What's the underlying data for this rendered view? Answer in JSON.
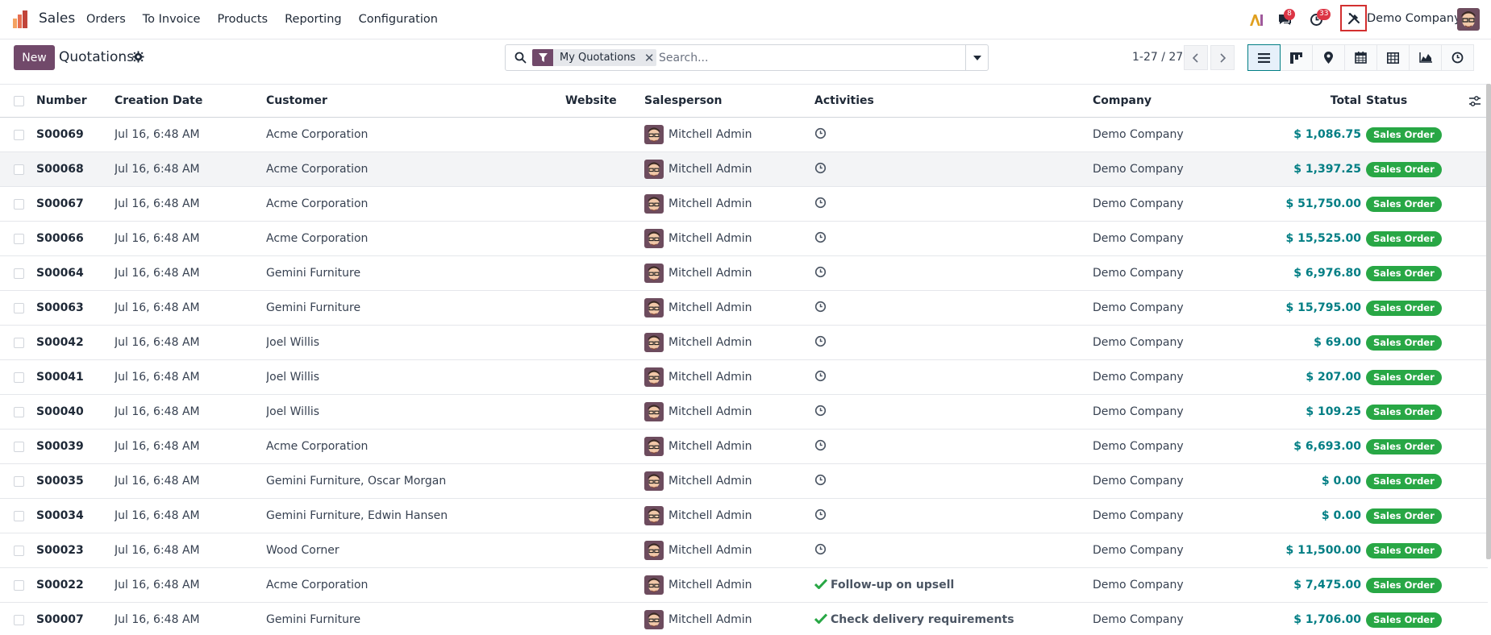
{
  "navbar": {
    "app_name": "Sales",
    "menu": [
      "Orders",
      "To Invoice",
      "Products",
      "Reporting",
      "Configuration"
    ],
    "chat_count": "8",
    "activity_count": "33",
    "company": "Demo Company"
  },
  "control": {
    "new_label": "New",
    "title": "Quotations",
    "facet_label": "My Quotations",
    "search_placeholder": "Search...",
    "pager": "1-27 / 27"
  },
  "table": {
    "headers": {
      "number": "Number",
      "date": "Creation Date",
      "customer": "Customer",
      "website": "Website",
      "salesperson": "Salesperson",
      "activities": "Activities",
      "company": "Company",
      "total": "Total",
      "status": "Status"
    },
    "rows": [
      {
        "number": "S00069",
        "date": "Jul 16, 6:48 AM",
        "customer": "Acme Corporation",
        "salesperson": "Mitchell Admin",
        "activity": "",
        "company": "Demo Company",
        "total": "$ 1,086.75",
        "status": "Sales Order"
      },
      {
        "number": "S00068",
        "date": "Jul 16, 6:48 AM",
        "customer": "Acme Corporation",
        "salesperson": "Mitchell Admin",
        "activity": "",
        "company": "Demo Company",
        "total": "$ 1,397.25",
        "status": "Sales Order"
      },
      {
        "number": "S00067",
        "date": "Jul 16, 6:48 AM",
        "customer": "Acme Corporation",
        "salesperson": "Mitchell Admin",
        "activity": "",
        "company": "Demo Company",
        "total": "$ 51,750.00",
        "status": "Sales Order"
      },
      {
        "number": "S00066",
        "date": "Jul 16, 6:48 AM",
        "customer": "Acme Corporation",
        "salesperson": "Mitchell Admin",
        "activity": "",
        "company": "Demo Company",
        "total": "$ 15,525.00",
        "status": "Sales Order"
      },
      {
        "number": "S00064",
        "date": "Jul 16, 6:48 AM",
        "customer": "Gemini Furniture",
        "salesperson": "Mitchell Admin",
        "activity": "",
        "company": "Demo Company",
        "total": "$ 6,976.80",
        "status": "Sales Order"
      },
      {
        "number": "S00063",
        "date": "Jul 16, 6:48 AM",
        "customer": "Gemini Furniture",
        "salesperson": "Mitchell Admin",
        "activity": "",
        "company": "Demo Company",
        "total": "$ 15,795.00",
        "status": "Sales Order"
      },
      {
        "number": "S00042",
        "date": "Jul 16, 6:48 AM",
        "customer": "Joel Willis",
        "salesperson": "Mitchell Admin",
        "activity": "",
        "company": "Demo Company",
        "total": "$ 69.00",
        "status": "Sales Order"
      },
      {
        "number": "S00041",
        "date": "Jul 16, 6:48 AM",
        "customer": "Joel Willis",
        "salesperson": "Mitchell Admin",
        "activity": "",
        "company": "Demo Company",
        "total": "$ 207.00",
        "status": "Sales Order"
      },
      {
        "number": "S00040",
        "date": "Jul 16, 6:48 AM",
        "customer": "Joel Willis",
        "salesperson": "Mitchell Admin",
        "activity": "",
        "company": "Demo Company",
        "total": "$ 109.25",
        "status": "Sales Order"
      },
      {
        "number": "S00039",
        "date": "Jul 16, 6:48 AM",
        "customer": "Acme Corporation",
        "salesperson": "Mitchell Admin",
        "activity": "",
        "company": "Demo Company",
        "total": "$ 6,693.00",
        "status": "Sales Order"
      },
      {
        "number": "S00035",
        "date": "Jul 16, 6:48 AM",
        "customer": "Gemini Furniture, Oscar Morgan",
        "salesperson": "Mitchell Admin",
        "activity": "",
        "company": "Demo Company",
        "total": "$ 0.00",
        "status": "Sales Order"
      },
      {
        "number": "S00034",
        "date": "Jul 16, 6:48 AM",
        "customer": "Gemini Furniture, Edwin Hansen",
        "salesperson": "Mitchell Admin",
        "activity": "",
        "company": "Demo Company",
        "total": "$ 0.00",
        "status": "Sales Order"
      },
      {
        "number": "S00023",
        "date": "Jul 16, 6:48 AM",
        "customer": "Wood Corner",
        "salesperson": "Mitchell Admin",
        "activity": "",
        "company": "Demo Company",
        "total": "$ 11,500.00",
        "status": "Sales Order"
      },
      {
        "number": "S00022",
        "date": "Jul 16, 6:48 AM",
        "customer": "Acme Corporation",
        "salesperson": "Mitchell Admin",
        "activity": "Follow-up on upsell",
        "company": "Demo Company",
        "total": "$ 7,475.00",
        "status": "Sales Order"
      },
      {
        "number": "S00007",
        "date": "Jul 16, 6:48 AM",
        "customer": "Gemini Furniture",
        "salesperson": "Mitchell Admin",
        "activity": "Check delivery requirements",
        "company": "Demo Company",
        "total": "$ 1,706.00",
        "status": "Sales Order"
      }
    ]
  },
  "colors": {
    "brand": "#71496a",
    "accent": "#017e84",
    "status": "#28a745",
    "badge": "#dc3545",
    "debug_outline": "#d32f2f"
  },
  "icons": {
    "activity_done": "check-icon",
    "activity_none": "clock-icon"
  }
}
